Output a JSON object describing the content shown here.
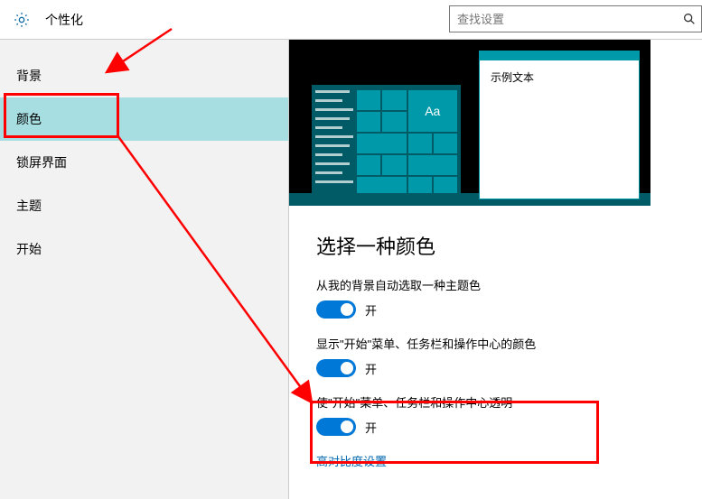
{
  "header": {
    "title": "个性化",
    "search_placeholder": "查找设置"
  },
  "sidebar": {
    "items": [
      {
        "label": "背景"
      },
      {
        "label": "颜色"
      },
      {
        "label": "锁屏界面"
      },
      {
        "label": "主题"
      },
      {
        "label": "开始"
      }
    ],
    "active_index": 1
  },
  "preview": {
    "tile_text": "Aa",
    "window_sample_text": "示例文本"
  },
  "main": {
    "heading": "选择一种颜色",
    "options": [
      {
        "label": "从我的背景自动选取一种主题色",
        "state_text": "开",
        "on": true
      },
      {
        "label": "显示\"开始\"菜单、任务栏和操作中心的颜色",
        "state_text": "开",
        "on": true
      },
      {
        "label": "使\"开始\"菜单、任务栏和操作中心透明",
        "state_text": "开",
        "on": true
      }
    ],
    "link": "高对比度设置"
  }
}
